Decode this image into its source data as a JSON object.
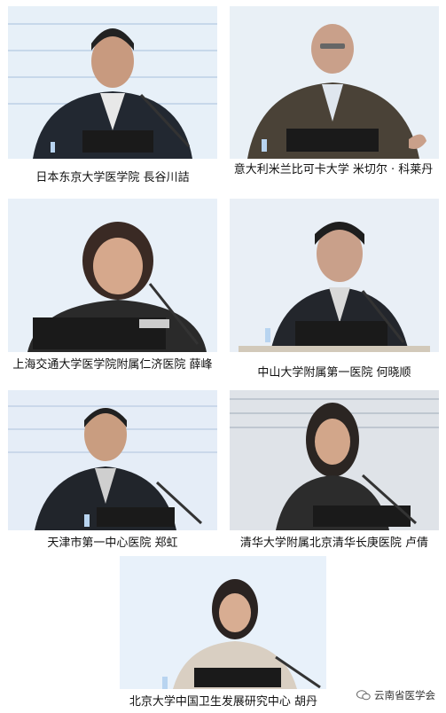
{
  "speakers": [
    {
      "caption": "日本东京大学医学院 長谷川詰"
    },
    {
      "caption": "意大利米兰比可卡大学 米切尔 · 科莱丹"
    },
    {
      "caption": "上海交通大学医学院附属仁济医院 薛峰"
    },
    {
      "caption": "中山大学附属第一医院 何晓顺"
    },
    {
      "caption": "天津市第一中心医院 郑虹"
    },
    {
      "caption": "清华大学附属北京清华长庚医院 卢倩"
    },
    {
      "caption": "北京大学中国卫生发展研究中心 胡丹"
    }
  ],
  "watermark": {
    "text": "云南省医学会",
    "icon": "wechat-icon"
  }
}
